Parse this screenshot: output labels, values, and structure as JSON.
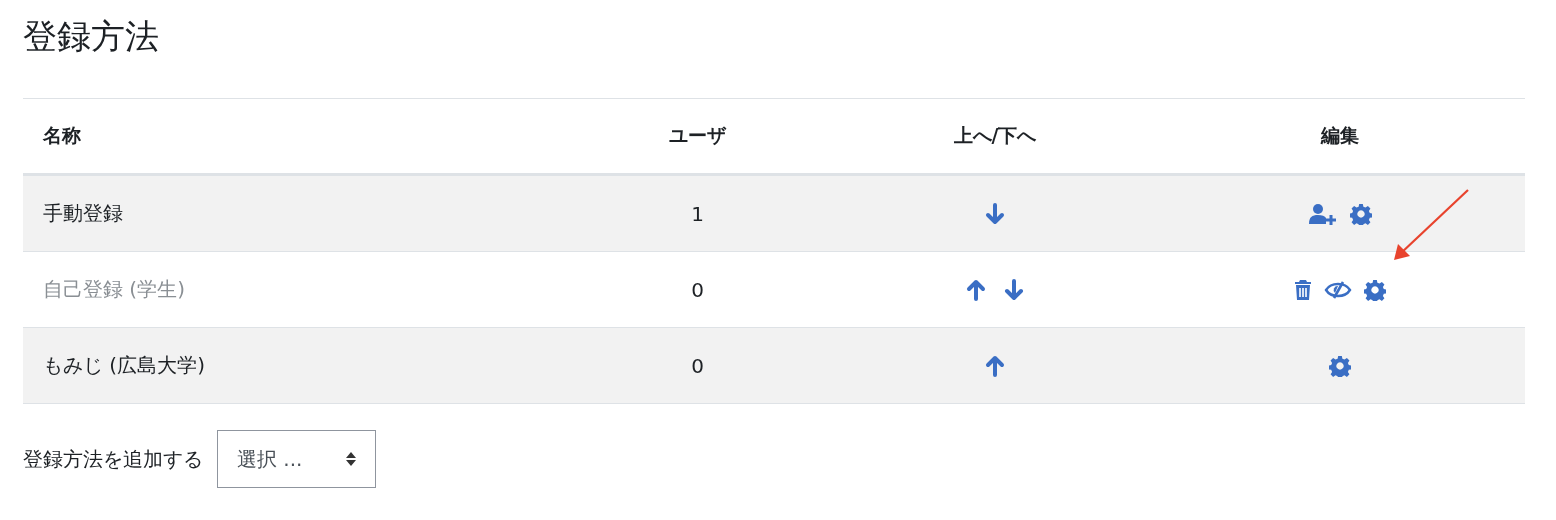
{
  "heading": "登録方法",
  "table": {
    "columns": [
      "名称",
      "ユーザ",
      "上へ/下へ",
      "編集"
    ],
    "rows": [
      {
        "name": "手動登録",
        "disabled": false,
        "users": "1",
        "moves": [
          {
            "kind": "down"
          }
        ],
        "actions": [
          {
            "kind": "enrol-users"
          },
          {
            "kind": "settings"
          }
        ]
      },
      {
        "name": "自己登録 (学生)",
        "disabled": true,
        "users": "0",
        "moves": [
          {
            "kind": "up"
          },
          {
            "kind": "down"
          }
        ],
        "actions": [
          {
            "kind": "delete"
          },
          {
            "kind": "hide"
          },
          {
            "kind": "settings"
          }
        ]
      },
      {
        "name": "もみじ (広島大学)",
        "disabled": false,
        "users": "0",
        "moves": [
          {
            "kind": "up"
          }
        ],
        "actions": [
          {
            "kind": "settings"
          }
        ]
      }
    ]
  },
  "add_method": {
    "label": "登録方法を追加する",
    "select": {
      "value": "選択 ..."
    }
  }
}
